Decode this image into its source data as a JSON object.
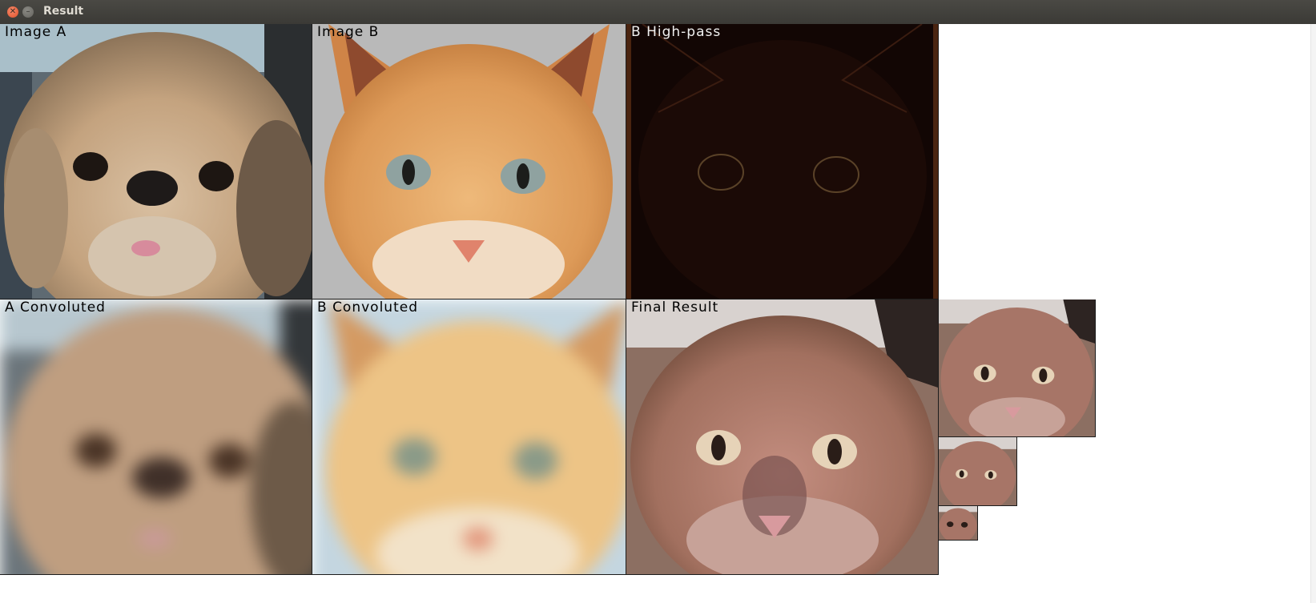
{
  "window": {
    "title": "Result",
    "close_icon": "close-icon",
    "minimize_icon": "minimize-icon"
  },
  "panels": {
    "image_a": {
      "label": "Image A",
      "content": "dog"
    },
    "image_b": {
      "label": "Image B",
      "content": "cat"
    },
    "b_highpass": {
      "label": "B High-pass",
      "content": "cat-highpass"
    },
    "a_convoluted": {
      "label": "A Convoluted",
      "content": "dog-blurred"
    },
    "b_convoluted": {
      "label": "B Convoluted",
      "content": "cat-blurred"
    },
    "final_result": {
      "label": "Final Result",
      "content": "hybrid"
    }
  },
  "pyramid": {
    "levels": [
      "1/2",
      "1/4",
      "1/8"
    ]
  },
  "colors": {
    "titlebar": "#3b3a36",
    "close": "#e95420",
    "dog_fur": "#c9a987",
    "cat_fur": "#e1a05e",
    "hybrid_fur": "#a9766a",
    "highpass_bg": "#120604"
  }
}
